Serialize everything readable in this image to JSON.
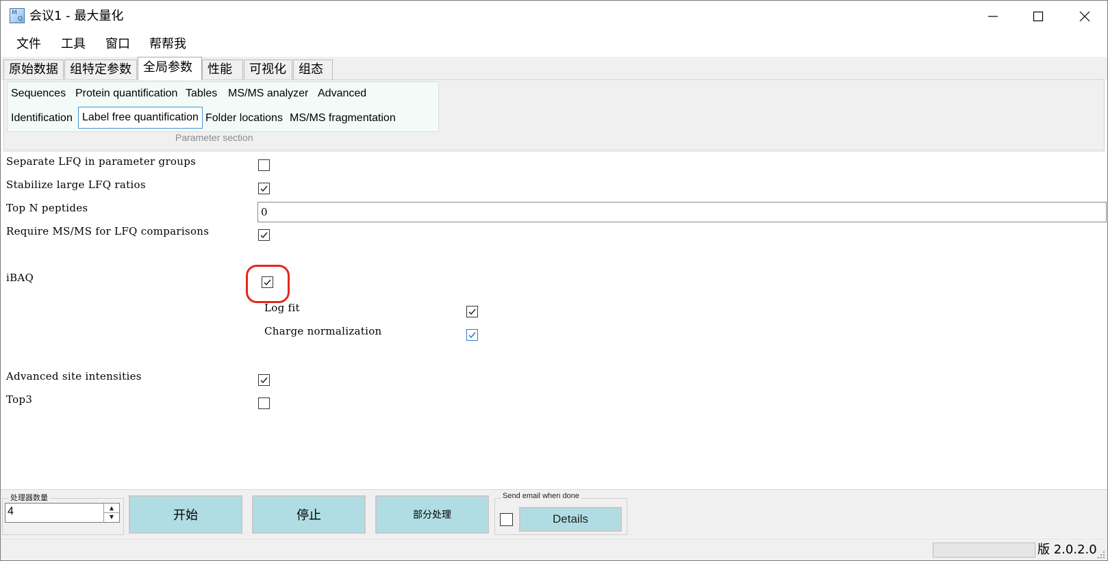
{
  "window": {
    "title": "会议1 - 最大量化",
    "app_icon": "maxquant-logo",
    "controls": [
      "minimize-icon",
      "maximize-icon",
      "close-icon"
    ]
  },
  "menu": [
    "文件",
    "工具",
    "窗口",
    "帮帮我"
  ],
  "main_tabs": [
    {
      "label": "原始数据",
      "active": false
    },
    {
      "label": "组特定参数",
      "active": false
    },
    {
      "label": "全局参数",
      "active": true
    },
    {
      "label": "性能",
      "active": false
    },
    {
      "label": "可视化",
      "active": false
    },
    {
      "label": "组态",
      "active": false
    }
  ],
  "parameter_section": {
    "caption": "Parameter section",
    "row1": [
      "Sequences",
      "Protein quantification",
      "Tables",
      "MS/MS analyzer",
      "Advanced"
    ],
    "row2": [
      "Identification",
      "Label free quantification",
      "Folder locations",
      "MS/MS fragmentation"
    ],
    "selected": "Label free quantification"
  },
  "lfq": {
    "separate_lfq": {
      "label": "Separate LFQ in parameter groups",
      "checked": false
    },
    "stabilize": {
      "label": "Stabilize large LFQ ratios",
      "checked": true
    },
    "top_n": {
      "label": "Top N peptides",
      "value": "0"
    },
    "require_msms": {
      "label": "Require MS/MS for LFQ comparisons",
      "checked": true
    },
    "ibaq": {
      "label": "iBAQ",
      "checked": true,
      "highlighted": true
    },
    "log_fit": {
      "label": "Log fit",
      "checked": true
    },
    "charge_norm": {
      "label": "Charge normalization",
      "checked": true
    },
    "advanced_site": {
      "label": "Advanced site intensities",
      "checked": true
    },
    "top3": {
      "label": "Top3",
      "checked": false
    }
  },
  "bottom": {
    "threads_label": "处理器数量",
    "threads_value": "4",
    "start_label": "开始",
    "stop_label": "停止",
    "partial_label": "部分处理",
    "email_group_label": "Send email when done",
    "email_checked": false,
    "details_label": "Details"
  },
  "status": {
    "version": "版 2.0.2.0"
  },
  "colors": {
    "button_fill": "#b0dde3",
    "subtab_bg": "#f2fbf7",
    "highlight": "#e2271d",
    "accent_blue": "#2a78c8"
  }
}
